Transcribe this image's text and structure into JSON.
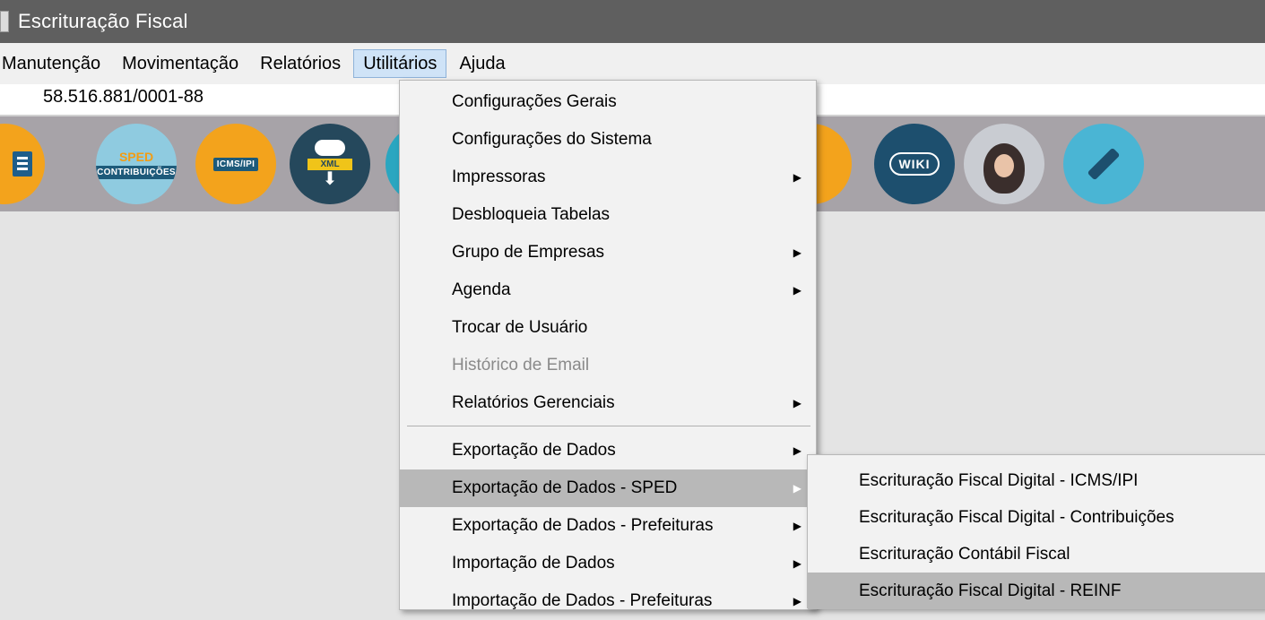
{
  "window": {
    "title": "Escrituração Fiscal"
  },
  "menubar": {
    "items": [
      {
        "label": "Manutenção"
      },
      {
        "label": "Movimentação"
      },
      {
        "label": "Relatórios"
      },
      {
        "label": "Utilitários"
      },
      {
        "label": "Ajuda"
      }
    ]
  },
  "company": {
    "cnpj": "58.516.881/0001-88"
  },
  "toolbar": {
    "icons": [
      {
        "name": "company-icon"
      },
      {
        "name": "sped-contribuicoes-icon",
        "line1": "SPED",
        "line2": "CONTRIBUIÇÕES"
      },
      {
        "name": "icms-ipi-icon",
        "tag": "ICMS/IPI"
      },
      {
        "name": "xml-download-icon",
        "tag": "XML"
      },
      {
        "name": "tool-icon"
      },
      {
        "name": "chat-icon"
      },
      {
        "name": "wiki-icon",
        "tag": "WIKI"
      },
      {
        "name": "assistant-avatar-icon"
      },
      {
        "name": "gavel-icon"
      }
    ]
  },
  "utilitarios_menu": {
    "items": [
      {
        "label": "Configurações Gerais"
      },
      {
        "label": "Configurações do Sistema"
      },
      {
        "label": "Impressoras"
      },
      {
        "label": "Desbloqueia Tabelas"
      },
      {
        "label": "Grupo de Empresas"
      },
      {
        "label": "Agenda"
      },
      {
        "label": "Trocar de Usuário"
      },
      {
        "label": "Histórico de Email"
      },
      {
        "label": "Relatórios Gerenciais"
      },
      {
        "label": "Exportação de Dados"
      },
      {
        "label": "Exportação de Dados - SPED"
      },
      {
        "label": "Exportação de Dados - Prefeituras"
      },
      {
        "label": "Importação de Dados"
      },
      {
        "label": "Importação de Dados - Prefeituras"
      }
    ]
  },
  "sped_submenu": {
    "items": [
      {
        "label": "Escrituração Fiscal Digital - ICMS/IPI"
      },
      {
        "label": "Escrituração Fiscal Digital - Contribuições"
      },
      {
        "label": "Escrituração Contábil Fiscal"
      },
      {
        "label": "Escrituração Fiscal Digital - REINF"
      }
    ]
  },
  "colors": {
    "titlebar": "#5f5f5f",
    "toolbar": "#a7a3a8",
    "highlight": "#b8b8b8",
    "menu_bg": "#f2f2f2"
  }
}
